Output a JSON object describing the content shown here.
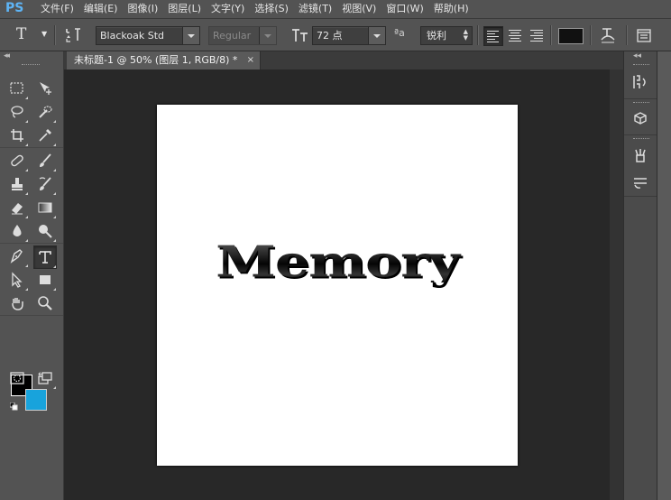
{
  "app": {
    "logo": "PS"
  },
  "menu": [
    "文件(F)",
    "编辑(E)",
    "图像(I)",
    "图层(L)",
    "文字(Y)",
    "选择(S)",
    "滤镜(T)",
    "视图(V)",
    "窗口(W)",
    "帮助(H)"
  ],
  "options": {
    "font_family": "Blackoak Std",
    "font_style": "Regular",
    "font_size": "72 点",
    "antialias_icon": "ªa",
    "antialias": "锐利",
    "text_color": "#111111"
  },
  "document": {
    "tab_title": "未标题-1 @ 50% (图层 1, RGB/8) *",
    "close_glyph": "×",
    "canvas_text": "Memory"
  },
  "colors": {
    "foreground": "#000000",
    "background": "#18a3dc"
  }
}
